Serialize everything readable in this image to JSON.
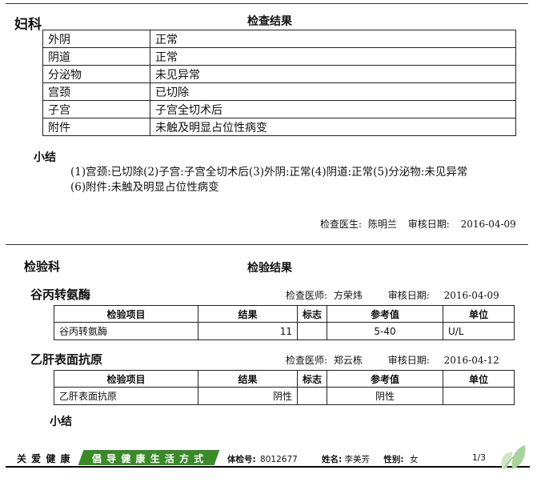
{
  "gynecology": {
    "dept": "妇科",
    "result_title": "检查结果",
    "rows": [
      {
        "item": "外阴",
        "value": "正常"
      },
      {
        "item": "阴道",
        "value": "正常"
      },
      {
        "item": "分泌物",
        "value": "未见异常"
      },
      {
        "item": "宫颈",
        "value": "已切除"
      },
      {
        "item": "子宫",
        "value": "子宫全切术后"
      },
      {
        "item": "附件",
        "value": "未触及明显占位性病变"
      }
    ],
    "summary_title": "小结",
    "summary_line1": "(1)宫颈:已切除(2)子宫:子宫全切术后(3)外阴:正常(4)阴道:正常(5)分泌物:未见异常",
    "summary_line2": "(6)附件:未触及明显占位性病变",
    "doctor_label": "检查医生:",
    "doctor": "陈明兰",
    "review_label": "审核日期:",
    "review_date": "2016-04-09"
  },
  "laboratory": {
    "dept": "检验科",
    "result_title": "检验结果",
    "headers": {
      "item": "检验项目",
      "result": "结果",
      "flag": "标志",
      "ref": "参考值",
      "unit": "单位"
    },
    "tests": [
      {
        "name": "谷丙转氨酶",
        "tech_label": "检查医师:",
        "tech": "方荣炜",
        "review_label": "审核日期:",
        "review_date": "2016-04-09",
        "row": {
          "item": "谷丙转氨酶",
          "result": "11",
          "flag": "",
          "ref": "5-40",
          "unit": "U/L"
        }
      },
      {
        "name": "乙肝表面抗原",
        "tech_label": "检查医师:",
        "tech": "郑云栋",
        "review_label": "审核日期:",
        "review_date": "2016-04-12",
        "row": {
          "item": "乙肝表面抗原",
          "result": "阴性",
          "flag": "",
          "ref": "阴性",
          "unit": ""
        }
      }
    ],
    "summary_title": "小结"
  },
  "footer": {
    "slogan_left": "关 爱 健 康",
    "slogan_right": "倡 导 健 康 生 活 方 式",
    "exam_no_label": "体检号:",
    "exam_no": "8012677",
    "name_label": "姓名:",
    "name": "李美芳",
    "gender_label": "性别:",
    "gender": "女",
    "page": "1/3",
    "accent_green": "#3a8a2a"
  }
}
